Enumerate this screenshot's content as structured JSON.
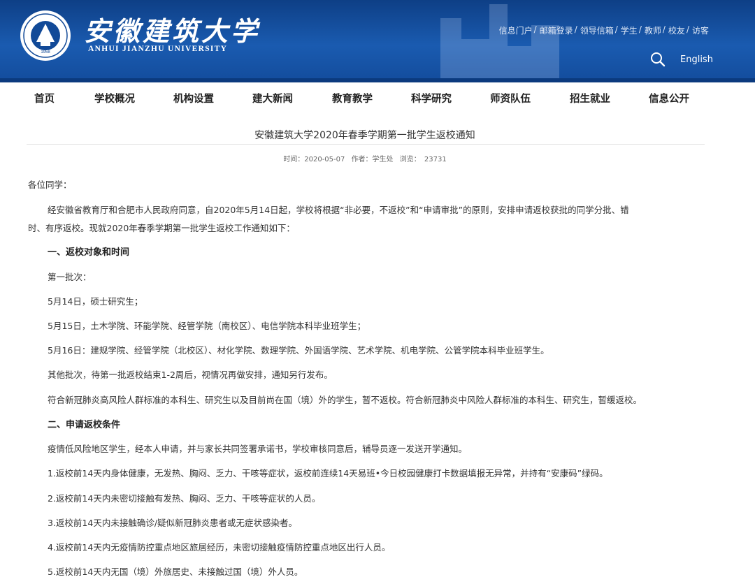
{
  "header": {
    "logo_cn": "安徽建筑大学",
    "logo_en": "ANHUI JIANZHU UNIVERSITY",
    "seal_year": "1958",
    "top_links": [
      "信息门户",
      "邮箱登录",
      "领导信箱",
      "学生",
      "教师",
      "校友",
      "访客"
    ],
    "language_link": "English",
    "brand_color": "#124a98"
  },
  "nav": {
    "items": [
      "首页",
      "学校概况",
      "机构设置",
      "建大新闻",
      "教育教学",
      "科学研究",
      "师资队伍",
      "招生就业",
      "信息公开"
    ]
  },
  "article": {
    "title": "安徽建筑大学2020年春季学期第一批学生返校通知",
    "meta_time": "时间：2020-05-07",
    "meta_author": "作者：学生处",
    "meta_views": "浏览：  23731",
    "greeting": "各位同学：",
    "intro_line1": "经安徽省教育厅和合肥市人民政府同意，自2020年5月14日起，学校将根据“非必要，不返校”和“申请审批”的原则，安排申请返校获批的同学分批、错",
    "intro_line2": "时、有序返校。现就2020年春季学期第一批学生返校工作通知如下：",
    "section1_heading": "一、返校对象和时间",
    "batch1": "第一批次：",
    "may14": "5月14日，硕士研究生；",
    "may15": "5月15日，土木学院、环能学院、经管学院（南校区）、电信学院本科毕业班学生；",
    "may16": "5月16日：建规学院、经管学院（北校区）、材化学院、数理学院、外国语学院、艺术学院、机电学院、公管学院本科毕业班学生。",
    "other_batches": "其他批次，待第一批返校结束1-2周后，视情况再做安排，通知另行发布。",
    "high_risk": "符合新冠肺炎高风险人群标准的本科生、研究生以及目前尚在国（境）外的学生，暂不返校。符合新冠肺炎中风险人群标准的本科生、研究生，暂缓返校。",
    "section2_heading": "二、申请返校条件",
    "condition_intro": "疫情低风险地区学生，经本人申请，并与家长共同签署承诺书，学校审核同意后，辅导员逐一发送开学通知。",
    "conditions": [
      "1.返校前14天内身体健康，无发热、胸闷、乏力、干咳等症状，返校前连续14天易班•今日校园健康打卡数据填报无异常，并持有“安康码”绿码。",
      "2.返校前14天内未密切接触有发热、胸闷、乏力、干咳等症状的人员。",
      "3.返校前14天内未接触确诊/疑似新冠肺炎患者或无症状感染者。",
      "4.返校前14天内无疫情防控重点地区旅居经历，未密切接触疫情防控重点地区出行人员。",
      "5.返校前14天内无国（境）外旅居史、未接触过国（境）外人员。"
    ]
  }
}
